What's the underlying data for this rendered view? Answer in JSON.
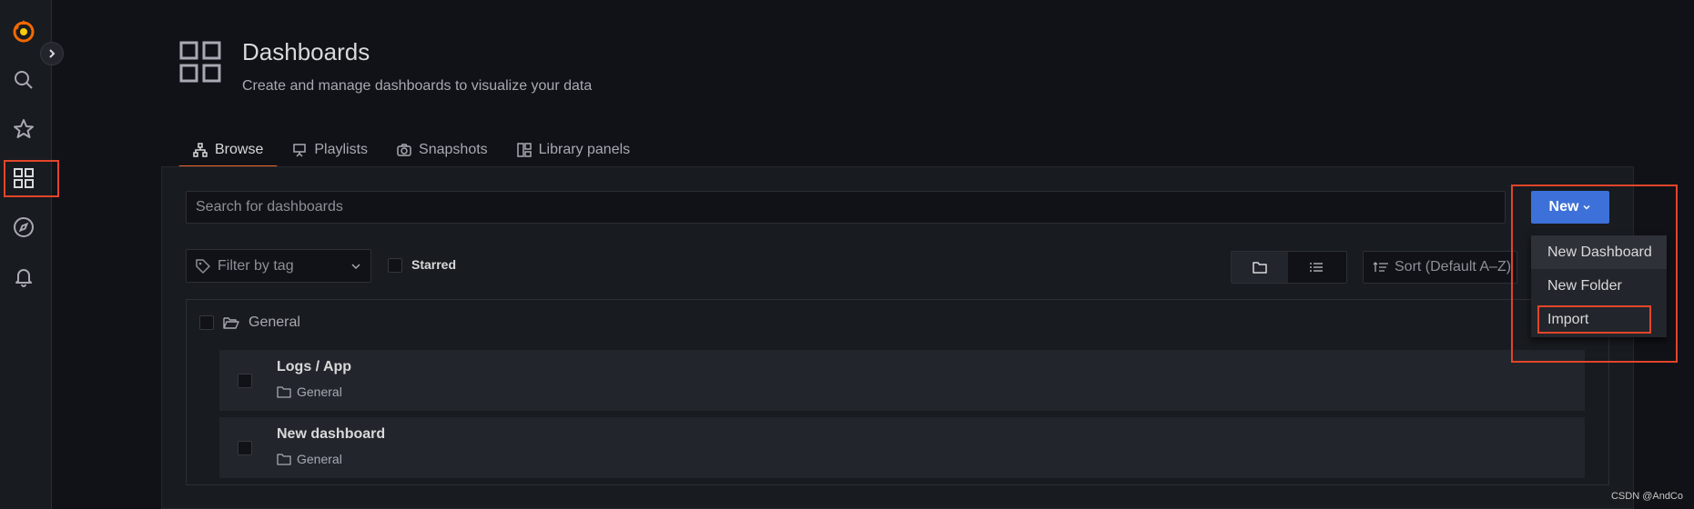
{
  "sidebar": {
    "items": [
      {
        "name": "grafana-logo-icon"
      },
      {
        "name": "search-icon"
      },
      {
        "name": "star-icon"
      },
      {
        "name": "dashboards-icon"
      },
      {
        "name": "explore-icon"
      },
      {
        "name": "alerting-bell-icon"
      }
    ]
  },
  "header": {
    "title": "Dashboards",
    "subtitle": "Create and manage dashboards to visualize your data"
  },
  "tabs": [
    {
      "label": "Browse",
      "icon": "sitemap-icon",
      "active": true
    },
    {
      "label": "Playlists",
      "icon": "presentation-icon",
      "active": false
    },
    {
      "label": "Snapshots",
      "icon": "camera-icon",
      "active": false
    },
    {
      "label": "Library panels",
      "icon": "library-panels-icon",
      "active": false
    }
  ],
  "search": {
    "placeholder": "Search for dashboards"
  },
  "filter": {
    "placeholder": "Filter by tag"
  },
  "starred": {
    "label": "Starred",
    "checked": false
  },
  "view": {
    "selected": "folder"
  },
  "sort": {
    "label": "Sort (Default A–Z)"
  },
  "list": {
    "folder": {
      "label": "General"
    },
    "items": [
      {
        "title": "Logs / App",
        "folder": "General"
      },
      {
        "title": "New dashboard",
        "folder": "General"
      }
    ]
  },
  "new_menu": {
    "button_label": "New",
    "items": [
      "New Dashboard",
      "New Folder",
      "Import"
    ]
  },
  "colors": {
    "accent": "#3d71d9",
    "highlight": "#e2452a",
    "tab_underline": "#f0672a"
  },
  "watermark": "CSDN @AndCo"
}
